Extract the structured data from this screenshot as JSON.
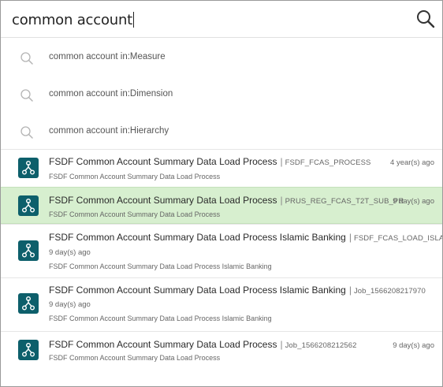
{
  "search": {
    "query": "common account"
  },
  "suggestions": [
    {
      "label": "common account in:Measure"
    },
    {
      "label": "common account in:Dimension"
    },
    {
      "label": "common account in:Hierarchy"
    }
  ],
  "results": [
    {
      "name": "FSDF Common Account Summary Data Load Process",
      "code": "FSDF_FCAS_PROCESS",
      "age": "4 year(s) ago",
      "description": "FSDF Common Account Summary Data Load Process",
      "selected": false
    },
    {
      "name": "FSDF Common Account Summary Data Load Process",
      "code": "PRUS_REG_FCAS_T2T_SUB_PR",
      "age": "9 day(s) ago",
      "description": "FSDF Common Account Summary Data Load Process",
      "selected": true
    },
    {
      "name": "FSDF Common Account Summary Data Load Process Islamic Banking",
      "code": "FSDF_FCAS_LOAD_ISLA",
      "age": "9 day(s) ago",
      "description": "FSDF Common Account Summary Data Load Process Islamic Banking",
      "selected": false
    },
    {
      "name": "FSDF Common Account Summary Data Load Process Islamic Banking",
      "code": "Job_1566208217970",
      "age": "9 day(s) ago",
      "description": "FSDF Common Account Summary Data Load Process Islamic Banking",
      "selected": false
    },
    {
      "name": "FSDF Common Account Summary Data Load Process",
      "code": "Job_1566208212562",
      "age": "9 day(s) ago",
      "description": "FSDF Common Account Summary Data Load Process",
      "selected": false
    }
  ],
  "colors": {
    "tile": "#0d5f6b",
    "selected_background": "#d7efcf"
  },
  "icons": {
    "search_button": "search-icon",
    "suggestion": "search-icon",
    "result_tile": "process-flow-icon"
  }
}
